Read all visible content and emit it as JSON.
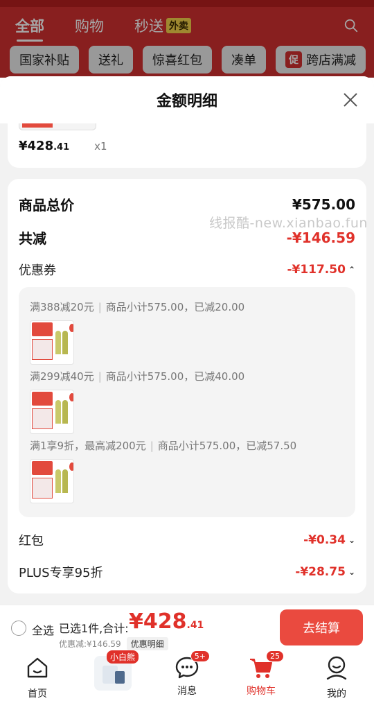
{
  "top": {
    "tabs": [
      {
        "label": "全部",
        "active": true
      },
      {
        "label": "购物",
        "active": false
      },
      {
        "label": "秒送",
        "active": false,
        "badge": "外卖"
      }
    ],
    "chips": [
      "国家补贴",
      "送礼",
      "惊喜红包",
      "凑单",
      "跨店满减"
    ],
    "chip_prefix": "促"
  },
  "sheet": {
    "title": "金额明细",
    "product": {
      "price_int": "¥428",
      "price_dec": ".41",
      "qty": "x1"
    },
    "summary": {
      "total_label": "商品总价",
      "total_value": "¥575.00",
      "reduce_label": "共减",
      "reduce_value": "-¥146.59"
    },
    "coupon": {
      "label": "优惠券",
      "value": "-¥117.50",
      "items": [
        {
          "rule": "满388减20元",
          "detail": "商品小计575.00，已减20.00"
        },
        {
          "rule": "满299减40元",
          "detail": "商品小计575.00，已减40.00"
        },
        {
          "rule": "满1享9折，最高减200元",
          "detail": "商品小计575.00，已减57.50"
        }
      ]
    },
    "redpack": {
      "label": "红包",
      "value": "-¥0.34"
    },
    "plus": {
      "label": "PLUS专享95折",
      "value": "-¥28.75"
    },
    "watermark": "线报酷-new.xianbao.fun"
  },
  "checkout": {
    "select_all": "全选",
    "selected_text": "已选1件,合计:",
    "total_int": "¥428",
    "total_dec": ".41",
    "discount_text": "优惠减:¥146.59",
    "detail_button": "优惠明细",
    "pay_button": "去结算"
  },
  "nav": {
    "items": [
      {
        "label": "首页"
      },
      {
        "label": "消息",
        "badge": "5+"
      },
      {
        "label": "购物车",
        "badge": "25"
      },
      {
        "label": "我的"
      }
    ],
    "promo_badge": "小白熊"
  },
  "colors": {
    "brand_red": "#e0312a",
    "header_red": "#d23030"
  }
}
